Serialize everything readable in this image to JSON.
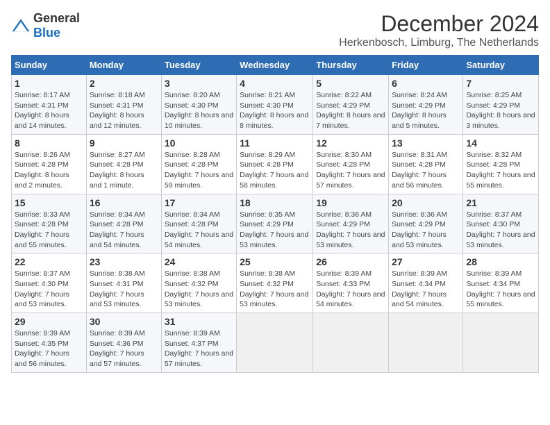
{
  "logo": {
    "general": "General",
    "blue": "Blue"
  },
  "title": "December 2024",
  "subtitle": "Herkenbosch, Limburg, The Netherlands",
  "weekdays": [
    "Sunday",
    "Monday",
    "Tuesday",
    "Wednesday",
    "Thursday",
    "Friday",
    "Saturday"
  ],
  "weeks": [
    [
      {
        "day": "1",
        "sunrise": "8:17 AM",
        "sunset": "4:31 PM",
        "daylight": "8 hours and 14 minutes."
      },
      {
        "day": "2",
        "sunrise": "8:18 AM",
        "sunset": "4:31 PM",
        "daylight": "8 hours and 12 minutes."
      },
      {
        "day": "3",
        "sunrise": "8:20 AM",
        "sunset": "4:30 PM",
        "daylight": "8 hours and 10 minutes."
      },
      {
        "day": "4",
        "sunrise": "8:21 AM",
        "sunset": "4:30 PM",
        "daylight": "8 hours and 8 minutes."
      },
      {
        "day": "5",
        "sunrise": "8:22 AM",
        "sunset": "4:29 PM",
        "daylight": "8 hours and 7 minutes."
      },
      {
        "day": "6",
        "sunrise": "8:24 AM",
        "sunset": "4:29 PM",
        "daylight": "8 hours and 5 minutes."
      },
      {
        "day": "7",
        "sunrise": "8:25 AM",
        "sunset": "4:29 PM",
        "daylight": "8 hours and 3 minutes."
      }
    ],
    [
      {
        "day": "8",
        "sunrise": "8:26 AM",
        "sunset": "4:28 PM",
        "daylight": "8 hours and 2 minutes."
      },
      {
        "day": "9",
        "sunrise": "8:27 AM",
        "sunset": "4:28 PM",
        "daylight": "8 hours and 1 minute."
      },
      {
        "day": "10",
        "sunrise": "8:28 AM",
        "sunset": "4:28 PM",
        "daylight": "7 hours and 59 minutes."
      },
      {
        "day": "11",
        "sunrise": "8:29 AM",
        "sunset": "4:28 PM",
        "daylight": "7 hours and 58 minutes."
      },
      {
        "day": "12",
        "sunrise": "8:30 AM",
        "sunset": "4:28 PM",
        "daylight": "7 hours and 57 minutes."
      },
      {
        "day": "13",
        "sunrise": "8:31 AM",
        "sunset": "4:28 PM",
        "daylight": "7 hours and 56 minutes."
      },
      {
        "day": "14",
        "sunrise": "8:32 AM",
        "sunset": "4:28 PM",
        "daylight": "7 hours and 55 minutes."
      }
    ],
    [
      {
        "day": "15",
        "sunrise": "8:33 AM",
        "sunset": "4:28 PM",
        "daylight": "7 hours and 55 minutes."
      },
      {
        "day": "16",
        "sunrise": "8:34 AM",
        "sunset": "4:28 PM",
        "daylight": "7 hours and 54 minutes."
      },
      {
        "day": "17",
        "sunrise": "8:34 AM",
        "sunset": "4:28 PM",
        "daylight": "7 hours and 54 minutes."
      },
      {
        "day": "18",
        "sunrise": "8:35 AM",
        "sunset": "4:29 PM",
        "daylight": "7 hours and 53 minutes."
      },
      {
        "day": "19",
        "sunrise": "8:36 AM",
        "sunset": "4:29 PM",
        "daylight": "7 hours and 53 minutes."
      },
      {
        "day": "20",
        "sunrise": "8:36 AM",
        "sunset": "4:29 PM",
        "daylight": "7 hours and 53 minutes."
      },
      {
        "day": "21",
        "sunrise": "8:37 AM",
        "sunset": "4:30 PM",
        "daylight": "7 hours and 53 minutes."
      }
    ],
    [
      {
        "day": "22",
        "sunrise": "8:37 AM",
        "sunset": "4:30 PM",
        "daylight": "7 hours and 53 minutes."
      },
      {
        "day": "23",
        "sunrise": "8:38 AM",
        "sunset": "4:31 PM",
        "daylight": "7 hours and 53 minutes."
      },
      {
        "day": "24",
        "sunrise": "8:38 AM",
        "sunset": "4:32 PM",
        "daylight": "7 hours and 53 minutes."
      },
      {
        "day": "25",
        "sunrise": "8:38 AM",
        "sunset": "4:32 PM",
        "daylight": "7 hours and 53 minutes."
      },
      {
        "day": "26",
        "sunrise": "8:39 AM",
        "sunset": "4:33 PM",
        "daylight": "7 hours and 54 minutes."
      },
      {
        "day": "27",
        "sunrise": "8:39 AM",
        "sunset": "4:34 PM",
        "daylight": "7 hours and 54 minutes."
      },
      {
        "day": "28",
        "sunrise": "8:39 AM",
        "sunset": "4:34 PM",
        "daylight": "7 hours and 55 minutes."
      }
    ],
    [
      {
        "day": "29",
        "sunrise": "8:39 AM",
        "sunset": "4:35 PM",
        "daylight": "7 hours and 56 minutes."
      },
      {
        "day": "30",
        "sunrise": "8:39 AM",
        "sunset": "4:36 PM",
        "daylight": "7 hours and 57 minutes."
      },
      {
        "day": "31",
        "sunrise": "8:39 AM",
        "sunset": "4:37 PM",
        "daylight": "7 hours and 57 minutes."
      },
      null,
      null,
      null,
      null
    ]
  ],
  "labels": {
    "sunrise": "Sunrise: ",
    "sunset": "Sunset: ",
    "daylight": "Daylight: "
  }
}
